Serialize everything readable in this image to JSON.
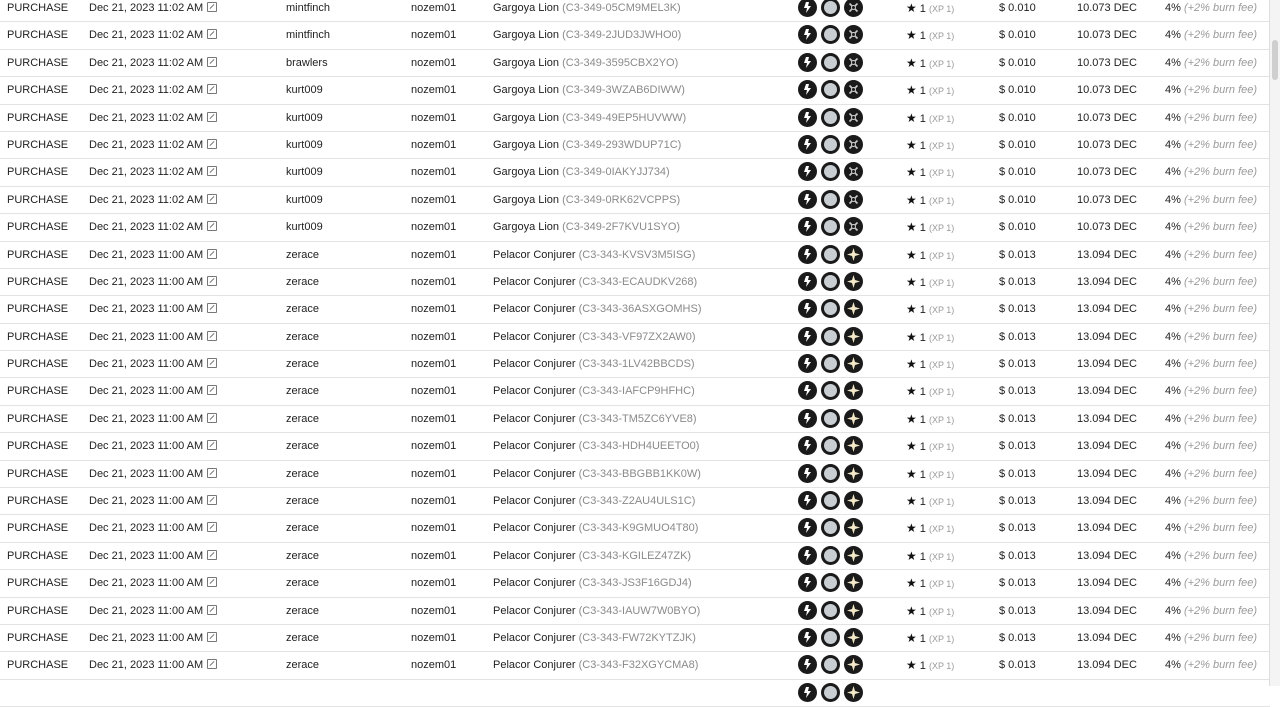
{
  "rows": [
    {
      "type": "PURCHASE",
      "date": "Dec 21, 2023 11:02 AM",
      "buyer": "mintfinch",
      "seller": "nozem01",
      "card": "Gargoya Lion",
      "card_id": "(C3-349-05CM9MEL3K)",
      "element": "death",
      "xp_value": "1",
      "xp_label": "(XP 1)",
      "usd": "$ 0.010",
      "dec": "10.073 DEC",
      "fee": "4%",
      "fee_note": "(+2% burn fee)"
    },
    {
      "type": "PURCHASE",
      "date": "Dec 21, 2023 11:02 AM",
      "buyer": "mintfinch",
      "seller": "nozem01",
      "card": "Gargoya Lion",
      "card_id": "(C3-349-2JUD3JWHO0)",
      "element": "death",
      "xp_value": "1",
      "xp_label": "(XP 1)",
      "usd": "$ 0.010",
      "dec": "10.073 DEC",
      "fee": "4%",
      "fee_note": "(+2% burn fee)"
    },
    {
      "type": "PURCHASE",
      "date": "Dec 21, 2023 11:02 AM",
      "buyer": "brawlers",
      "seller": "nozem01",
      "card": "Gargoya Lion",
      "card_id": "(C3-349-3595CBX2YO)",
      "element": "death",
      "xp_value": "1",
      "xp_label": "(XP 1)",
      "usd": "$ 0.010",
      "dec": "10.073 DEC",
      "fee": "4%",
      "fee_note": "(+2% burn fee)"
    },
    {
      "type": "PURCHASE",
      "date": "Dec 21, 2023 11:02 AM",
      "buyer": "kurt009",
      "seller": "nozem01",
      "card": "Gargoya Lion",
      "card_id": "(C3-349-3WZAB6DIWW)",
      "element": "death",
      "xp_value": "1",
      "xp_label": "(XP 1)",
      "usd": "$ 0.010",
      "dec": "10.073 DEC",
      "fee": "4%",
      "fee_note": "(+2% burn fee)"
    },
    {
      "type": "PURCHASE",
      "date": "Dec 21, 2023 11:02 AM",
      "buyer": "kurt009",
      "seller": "nozem01",
      "card": "Gargoya Lion",
      "card_id": "(C3-349-49EP5HUVWW)",
      "element": "death",
      "xp_value": "1",
      "xp_label": "(XP 1)",
      "usd": "$ 0.010",
      "dec": "10.073 DEC",
      "fee": "4%",
      "fee_note": "(+2% burn fee)"
    },
    {
      "type": "PURCHASE",
      "date": "Dec 21, 2023 11:02 AM",
      "buyer": "kurt009",
      "seller": "nozem01",
      "card": "Gargoya Lion",
      "card_id": "(C3-349-293WDUP71C)",
      "element": "death",
      "xp_value": "1",
      "xp_label": "(XP 1)",
      "usd": "$ 0.010",
      "dec": "10.073 DEC",
      "fee": "4%",
      "fee_note": "(+2% burn fee)"
    },
    {
      "type": "PURCHASE",
      "date": "Dec 21, 2023 11:02 AM",
      "buyer": "kurt009",
      "seller": "nozem01",
      "card": "Gargoya Lion",
      "card_id": "(C3-349-0IAKYJJ734)",
      "element": "death",
      "xp_value": "1",
      "xp_label": "(XP 1)",
      "usd": "$ 0.010",
      "dec": "10.073 DEC",
      "fee": "4%",
      "fee_note": "(+2% burn fee)"
    },
    {
      "type": "PURCHASE",
      "date": "Dec 21, 2023 11:02 AM",
      "buyer": "kurt009",
      "seller": "nozem01",
      "card": "Gargoya Lion",
      "card_id": "(C3-349-0RK62VCPPS)",
      "element": "death",
      "xp_value": "1",
      "xp_label": "(XP 1)",
      "usd": "$ 0.010",
      "dec": "10.073 DEC",
      "fee": "4%",
      "fee_note": "(+2% burn fee)"
    },
    {
      "type": "PURCHASE",
      "date": "Dec 21, 2023 11:02 AM",
      "buyer": "kurt009",
      "seller": "nozem01",
      "card": "Gargoya Lion",
      "card_id": "(C3-349-2F7KVU1SYO)",
      "element": "death",
      "xp_value": "1",
      "xp_label": "(XP 1)",
      "usd": "$ 0.010",
      "dec": "10.073 DEC",
      "fee": "4%",
      "fee_note": "(+2% burn fee)"
    },
    {
      "type": "PURCHASE",
      "date": "Dec 21, 2023 11:00 AM",
      "buyer": "zerace",
      "seller": "nozem01",
      "card": "Pelacor Conjurer",
      "card_id": "(C3-343-KVSV3M5ISG)",
      "element": "life",
      "xp_value": "1",
      "xp_label": "(XP 1)",
      "usd": "$ 0.013",
      "dec": "13.094 DEC",
      "fee": "4%",
      "fee_note": "(+2% burn fee)"
    },
    {
      "type": "PURCHASE",
      "date": "Dec 21, 2023 11:00 AM",
      "buyer": "zerace",
      "seller": "nozem01",
      "card": "Pelacor Conjurer",
      "card_id": "(C3-343-ECAUDKV268)",
      "element": "life",
      "xp_value": "1",
      "xp_label": "(XP 1)",
      "usd": "$ 0.013",
      "dec": "13.094 DEC",
      "fee": "4%",
      "fee_note": "(+2% burn fee)"
    },
    {
      "type": "PURCHASE",
      "date": "Dec 21, 2023 11:00 AM",
      "buyer": "zerace",
      "seller": "nozem01",
      "card": "Pelacor Conjurer",
      "card_id": "(C3-343-36ASXGOMHS)",
      "element": "life",
      "xp_value": "1",
      "xp_label": "(XP 1)",
      "usd": "$ 0.013",
      "dec": "13.094 DEC",
      "fee": "4%",
      "fee_note": "(+2% burn fee)"
    },
    {
      "type": "PURCHASE",
      "date": "Dec 21, 2023 11:00 AM",
      "buyer": "zerace",
      "seller": "nozem01",
      "card": "Pelacor Conjurer",
      "card_id": "(C3-343-VF97ZX2AW0)",
      "element": "life",
      "xp_value": "1",
      "xp_label": "(XP 1)",
      "usd": "$ 0.013",
      "dec": "13.094 DEC",
      "fee": "4%",
      "fee_note": "(+2% burn fee)"
    },
    {
      "type": "PURCHASE",
      "date": "Dec 21, 2023 11:00 AM",
      "buyer": "zerace",
      "seller": "nozem01",
      "card": "Pelacor Conjurer",
      "card_id": "(C3-343-1LV42BBCDS)",
      "element": "life",
      "xp_value": "1",
      "xp_label": "(XP 1)",
      "usd": "$ 0.013",
      "dec": "13.094 DEC",
      "fee": "4%",
      "fee_note": "(+2% burn fee)"
    },
    {
      "type": "PURCHASE",
      "date": "Dec 21, 2023 11:00 AM",
      "buyer": "zerace",
      "seller": "nozem01",
      "card": "Pelacor Conjurer",
      "card_id": "(C3-343-IAFCP9HFHC)",
      "element": "life",
      "xp_value": "1",
      "xp_label": "(XP 1)",
      "usd": "$ 0.013",
      "dec": "13.094 DEC",
      "fee": "4%",
      "fee_note": "(+2% burn fee)"
    },
    {
      "type": "PURCHASE",
      "date": "Dec 21, 2023 11:00 AM",
      "buyer": "zerace",
      "seller": "nozem01",
      "card": "Pelacor Conjurer",
      "card_id": "(C3-343-TM5ZC6YVE8)",
      "element": "life",
      "xp_value": "1",
      "xp_label": "(XP 1)",
      "usd": "$ 0.013",
      "dec": "13.094 DEC",
      "fee": "4%",
      "fee_note": "(+2% burn fee)"
    },
    {
      "type": "PURCHASE",
      "date": "Dec 21, 2023 11:00 AM",
      "buyer": "zerace",
      "seller": "nozem01",
      "card": "Pelacor Conjurer",
      "card_id": "(C3-343-HDH4UEETO0)",
      "element": "life",
      "xp_value": "1",
      "xp_label": "(XP 1)",
      "usd": "$ 0.013",
      "dec": "13.094 DEC",
      "fee": "4%",
      "fee_note": "(+2% burn fee)"
    },
    {
      "type": "PURCHASE",
      "date": "Dec 21, 2023 11:00 AM",
      "buyer": "zerace",
      "seller": "nozem01",
      "card": "Pelacor Conjurer",
      "card_id": "(C3-343-BBGBB1KK0W)",
      "element": "life",
      "xp_value": "1",
      "xp_label": "(XP 1)",
      "usd": "$ 0.013",
      "dec": "13.094 DEC",
      "fee": "4%",
      "fee_note": "(+2% burn fee)"
    },
    {
      "type": "PURCHASE",
      "date": "Dec 21, 2023 11:00 AM",
      "buyer": "zerace",
      "seller": "nozem01",
      "card": "Pelacor Conjurer",
      "card_id": "(C3-343-Z2AU4ULS1C)",
      "element": "life",
      "xp_value": "1",
      "xp_label": "(XP 1)",
      "usd": "$ 0.013",
      "dec": "13.094 DEC",
      "fee": "4%",
      "fee_note": "(+2% burn fee)"
    },
    {
      "type": "PURCHASE",
      "date": "Dec 21, 2023 11:00 AM",
      "buyer": "zerace",
      "seller": "nozem01",
      "card": "Pelacor Conjurer",
      "card_id": "(C3-343-K9GMUO4T80)",
      "element": "life",
      "xp_value": "1",
      "xp_label": "(XP 1)",
      "usd": "$ 0.013",
      "dec": "13.094 DEC",
      "fee": "4%",
      "fee_note": "(+2% burn fee)"
    },
    {
      "type": "PURCHASE",
      "date": "Dec 21, 2023 11:00 AM",
      "buyer": "zerace",
      "seller": "nozem01",
      "card": "Pelacor Conjurer",
      "card_id": "(C3-343-KGILEZ47ZK)",
      "element": "life",
      "xp_value": "1",
      "xp_label": "(XP 1)",
      "usd": "$ 0.013",
      "dec": "13.094 DEC",
      "fee": "4%",
      "fee_note": "(+2% burn fee)"
    },
    {
      "type": "PURCHASE",
      "date": "Dec 21, 2023 11:00 AM",
      "buyer": "zerace",
      "seller": "nozem01",
      "card": "Pelacor Conjurer",
      "card_id": "(C3-343-JS3F16GDJ4)",
      "element": "life",
      "xp_value": "1",
      "xp_label": "(XP 1)",
      "usd": "$ 0.013",
      "dec": "13.094 DEC",
      "fee": "4%",
      "fee_note": "(+2% burn fee)"
    },
    {
      "type": "PURCHASE",
      "date": "Dec 21, 2023 11:00 AM",
      "buyer": "zerace",
      "seller": "nozem01",
      "card": "Pelacor Conjurer",
      "card_id": "(C3-343-IAUW7W0BYO)",
      "element": "life",
      "xp_value": "1",
      "xp_label": "(XP 1)",
      "usd": "$ 0.013",
      "dec": "13.094 DEC",
      "fee": "4%",
      "fee_note": "(+2% burn fee)"
    },
    {
      "type": "PURCHASE",
      "date": "Dec 21, 2023 11:00 AM",
      "buyer": "zerace",
      "seller": "nozem01",
      "card": "Pelacor Conjurer",
      "card_id": "(C3-343-FW72KYTZJK)",
      "element": "life",
      "xp_value": "1",
      "xp_label": "(XP 1)",
      "usd": "$ 0.013",
      "dec": "13.094 DEC",
      "fee": "4%",
      "fee_note": "(+2% burn fee)"
    },
    {
      "type": "PURCHASE",
      "date": "Dec 21, 2023 11:00 AM",
      "buyer": "zerace",
      "seller": "nozem01",
      "card": "Pelacor Conjurer",
      "card_id": "(C3-343-F32XGYCMA8)",
      "element": "life",
      "xp_value": "1",
      "xp_label": "(XP 1)",
      "usd": "$ 0.013",
      "dec": "13.094 DEC",
      "fee": "4%",
      "fee_note": "(+2% burn fee)"
    },
    {
      "type": "",
      "date": "",
      "buyer": "",
      "seller": "",
      "card": "",
      "card_id": "",
      "element": "life",
      "xp_value": "",
      "xp_label": "",
      "usd": "",
      "dec": "",
      "fee": "",
      "fee_note": ""
    }
  ],
  "icon_names": {
    "edition": "edition-icon",
    "rarity": "rarity-common-icon",
    "death": "death-element-icon",
    "life": "life-element-icon",
    "external": "external-link-icon",
    "star": "star-icon"
  },
  "colors": {
    "row_border": "#e3e3e3",
    "muted_text": "#8a8a8a",
    "icon_dark": "#1a1a1a"
  }
}
